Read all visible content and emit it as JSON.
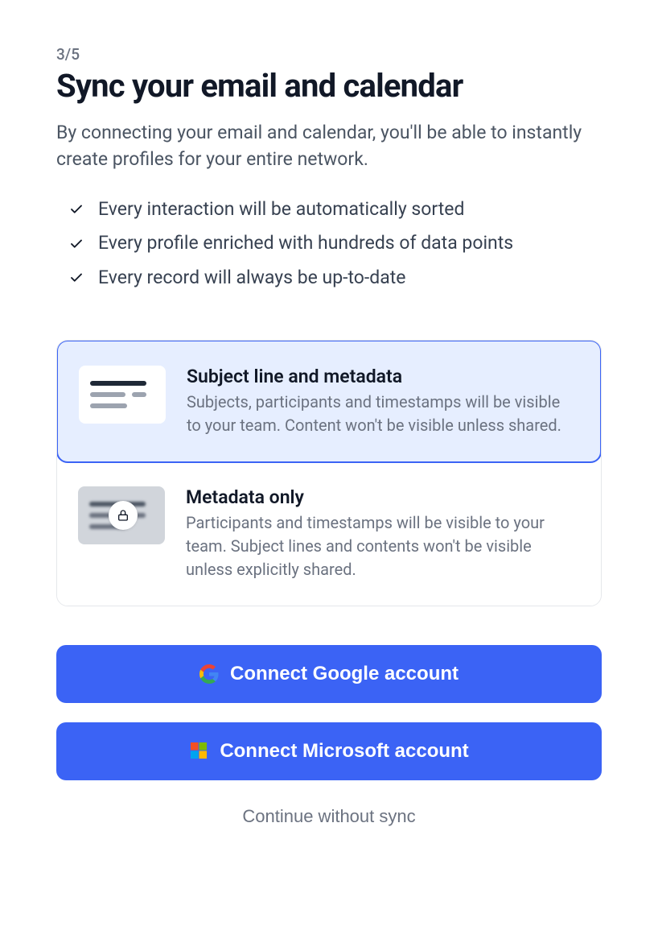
{
  "step": "3/5",
  "title": "Sync your email and calendar",
  "subtitle": "By connecting your email and calendar, you'll be able to instantly create profiles for your entire network.",
  "bullets": [
    "Every interaction will be automatically sorted",
    "Every profile enriched with hundreds of data points",
    "Every record will always be up-to-date"
  ],
  "options": [
    {
      "title": "Subject line and metadata",
      "description": "Subjects, participants and timestamps will be visible to your team. Content won't be visible unless shared.",
      "selected": true
    },
    {
      "title": "Metadata only",
      "description": "Participants and timestamps will be visible to your team. Subject lines and contents won't be visible unless explicitly shared.",
      "selected": false
    }
  ],
  "buttons": {
    "google": "Connect Google account",
    "microsoft": "Connect Microsoft account",
    "skip": "Continue without sync"
  }
}
